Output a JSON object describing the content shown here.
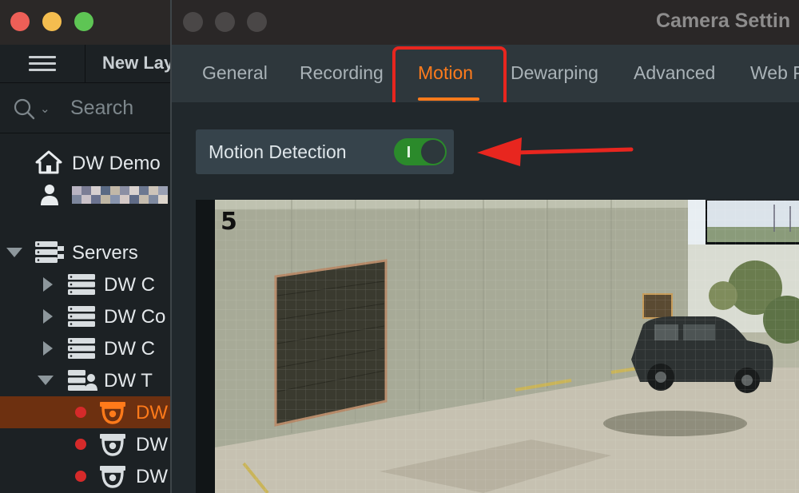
{
  "main_window": {
    "layout_tab": "New Lay",
    "search_label": "Search",
    "tree": {
      "site": "DW Demo",
      "servers_label": "Servers",
      "server_items": [
        "DW C",
        "DW Co",
        "DW C",
        "DW T"
      ],
      "camera_items": [
        "DW",
        "DW",
        "DW"
      ]
    }
  },
  "dialog": {
    "title": "Camera Settin",
    "tabs": [
      "General",
      "Recording",
      "Motion",
      "Dewarping",
      "Advanced",
      "Web P"
    ],
    "active_tab": "Motion",
    "motion_detection_label": "Motion Detection",
    "motion_detection_enabled": true,
    "camera_number": "5"
  },
  "colors": {
    "accent": "#ff7b1c",
    "annotation": "#e8261f",
    "toggle_on": "#2b8a2b",
    "recording_dot": "#d52a2a"
  }
}
